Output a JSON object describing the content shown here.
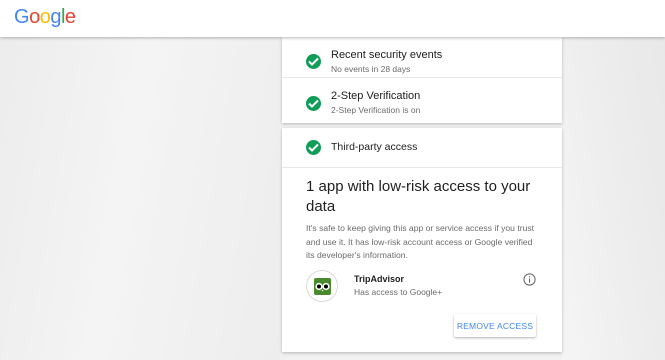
{
  "header": {
    "logo_letters": [
      {
        "ch": "G",
        "color": "#4285F4"
      },
      {
        "ch": "o",
        "color": "#EA4335"
      },
      {
        "ch": "o",
        "color": "#FBBC05"
      },
      {
        "ch": "g",
        "color": "#4285F4"
      },
      {
        "ch": "l",
        "color": "#34A853"
      },
      {
        "ch": "e",
        "color": "#EA4335"
      }
    ]
  },
  "checks": {
    "recent_events": {
      "title": "Recent security events",
      "subtitle": "No events in 28 days"
    },
    "two_step": {
      "title": "2-Step Verification",
      "subtitle": "2-Step Verification is on"
    },
    "third_party": {
      "title": "Third-party access"
    }
  },
  "third_party": {
    "headline": "1 app with low-risk access to your data",
    "description": "It's safe to keep giving this app or service access if you trust and use it. It has low-risk account access or Google verified its developer's information.",
    "app": {
      "name": "TripAdvisor",
      "access": "Has access to Google+",
      "icon": "tripadvisor-owl-icon"
    },
    "remove_label": "REMOVE ACCESS"
  },
  "colors": {
    "check_green": "#0F9D58",
    "link_blue": "#4285F4"
  }
}
